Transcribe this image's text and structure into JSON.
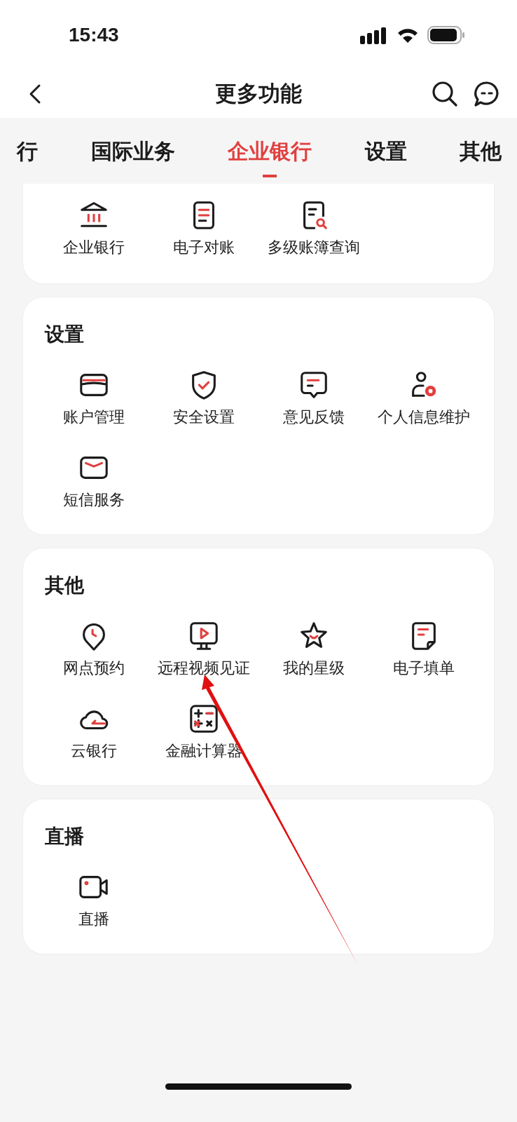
{
  "status_bar": {
    "time": "15:43"
  },
  "nav": {
    "title": "更多功能"
  },
  "tabs": [
    {
      "label": "行",
      "selected": false
    },
    {
      "label": "国际业务",
      "selected": false
    },
    {
      "label": "企业银行",
      "selected": true
    },
    {
      "label": "设置",
      "selected": false
    },
    {
      "label": "其他",
      "selected": false
    }
  ],
  "sections": [
    {
      "items": [
        "企业银行",
        "电子对账",
        "多级账簿查询"
      ]
    },
    {
      "title": "设置",
      "items": [
        "账户管理",
        "安全设置",
        "意见反馈",
        "个人信息维护",
        "短信服务"
      ]
    },
    {
      "title": "其他",
      "items": [
        "网点预约",
        "远程视频见证",
        "我的星级",
        "电子填单",
        "云银行",
        "金融计算器"
      ]
    },
    {
      "title": "直播",
      "items": [
        "直播"
      ]
    }
  ]
}
